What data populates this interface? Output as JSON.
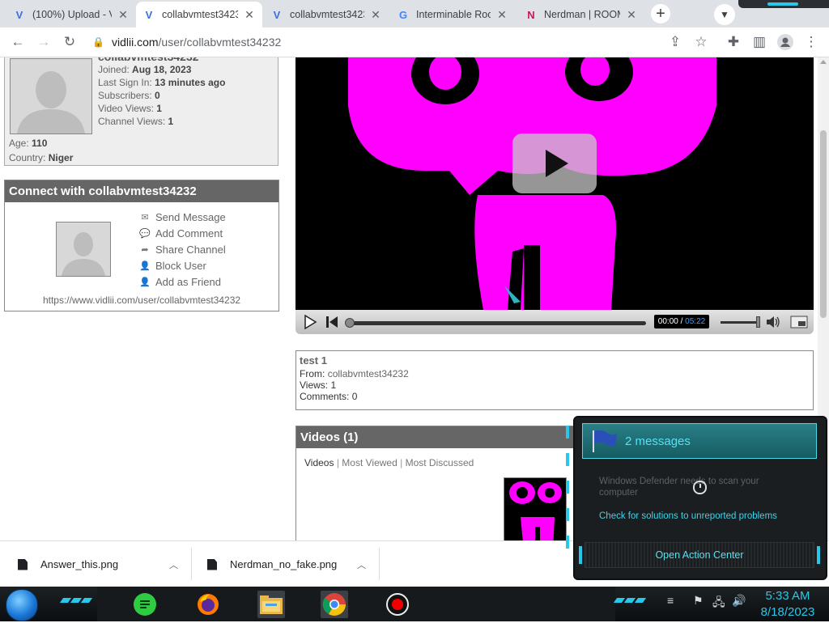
{
  "browser": {
    "tabs": [
      {
        "title": "(100%) Upload - V",
        "favicon": "V"
      },
      {
        "title": "collabvmtest3423",
        "favicon": "V"
      },
      {
        "title": "collabvmtest3423",
        "favicon": "V"
      },
      {
        "title": "Interminable Roo",
        "favicon": "G"
      },
      {
        "title": "Nerdman | ROOM",
        "favicon": "N"
      }
    ],
    "url_host": "vidlii.com",
    "url_path": "/user/collabvmtest34232"
  },
  "profile": {
    "username": "collabvmtest34232",
    "joined_label": "Joined:",
    "joined": "Aug 18, 2023",
    "last_sign_in_label": "Last Sign In:",
    "last_sign_in": "13 minutes ago",
    "subscribers_label": "Subscribers:",
    "subscribers": "0",
    "video_views_label": "Video Views:",
    "video_views": "1",
    "channel_views_label": "Channel Views:",
    "channel_views": "1",
    "age_label": "Age:",
    "age": "110",
    "country_label": "Country:",
    "country": "Niger"
  },
  "connect": {
    "title": "Connect with collabvmtest34232",
    "actions": [
      "Send Message",
      "Add Comment",
      "Share Channel",
      "Block User",
      "Add as Friend"
    ],
    "channel_url": "https://www.vidlii.com/user/collabvmtest34232"
  },
  "player": {
    "current_time": "00:00",
    "separator": "/",
    "duration": "05:22"
  },
  "video_info": {
    "title": "test 1",
    "from_label": "From:",
    "from": "collabvmtest34232",
    "views_label": "Views:",
    "views": "1",
    "comments_label": "Comments:",
    "comments": "0"
  },
  "videos_section": {
    "title": "Videos (1)",
    "tab_current": "Videos",
    "tab_most_viewed": "Most Viewed",
    "tab_most_discussed": "Most Discussed",
    "divider": "|"
  },
  "downloads": [
    {
      "name": "Answer_this.png"
    },
    {
      "name": "Nerdman_no_fake.png"
    }
  ],
  "action_center": {
    "messages": "2 messages",
    "item_dim": "Windows Defender needs to scan your computer",
    "item_link": "Check for solutions to unreported problems",
    "open_button": "Open Action Center"
  },
  "taskbar": {
    "time": "5:33 AM",
    "date": "8/18/2023"
  },
  "colors": {
    "accent": "#29c7e9",
    "magenta": "#ff00ff",
    "header_gray": "#666666"
  }
}
